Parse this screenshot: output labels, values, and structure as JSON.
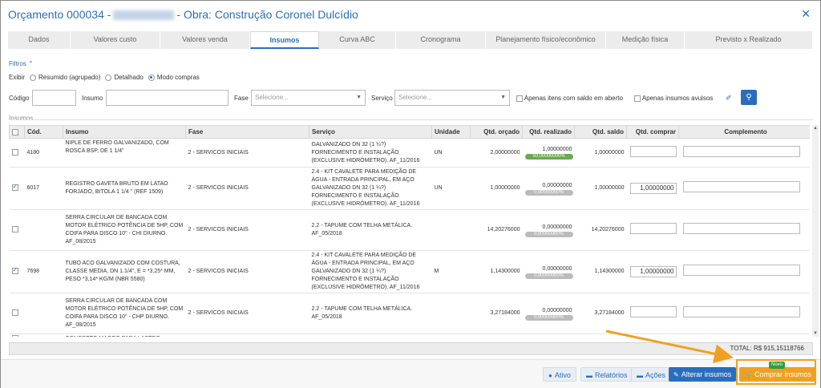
{
  "header": {
    "title_prefix": "Orçamento 000034 -",
    "title_suffix": "- Obra: Construção Coronel Dulcídio",
    "close_glyph": "✕"
  },
  "tabs": [
    {
      "label": "Dados"
    },
    {
      "label": "Valores custo"
    },
    {
      "label": "Valores venda"
    },
    {
      "label": "Insumos"
    },
    {
      "label": "Curva ABC"
    },
    {
      "label": "Cronograma"
    },
    {
      "label": "Planejamento físico/econômico"
    },
    {
      "label": "Medição física"
    },
    {
      "label": "Previsto x Realizado"
    }
  ],
  "active_tab": "Insumos",
  "filters": {
    "heading": "Filtros",
    "exibir_label": "Exibir",
    "exibir_options": [
      "Resumido (agrupado)",
      "Detalhado",
      "Modo compras"
    ],
    "exibir_selected": "Modo compras",
    "codigo_label": "Código",
    "insumo_label": "Insumo",
    "fase_label": "Fase",
    "fase_placeholder": "Selecione...",
    "servico_label": "Serviço",
    "servico_placeholder": "Selecione...",
    "saldo_label": "Apenas itens com saldo em aberto",
    "avulsos_label": "Apenas insumos avulsos"
  },
  "section_label": "Insumos",
  "table": {
    "columns": [
      "Cód.",
      "Insumo",
      "Fase",
      "Serviço",
      "Unidade",
      "Qtd. orçado",
      "Qtd. realizado",
      "Qtd. saldo",
      "Qtd. comprar",
      "Complemento"
    ],
    "rows": [
      {
        "checked": false,
        "cod": "4180",
        "insumo": "NIPLE DE FERRO GALVANIZADO, COM ROSCA BSP, DE 1 1/4\"",
        "fase": "2 - SERVICOS INICIAIS",
        "servico": "GALVANIZADO DN 32 (1 ¼?) FORNECIMENTO E INSTALAÇÃO (EXCLUSIVE HIDRÔMETRO). AF_11/2016",
        "unidade": "UN",
        "orcado": "2,00000000",
        "realizado": "1,00000000",
        "pill": "50,00000000%",
        "pill_green": true,
        "saldo": "1,00000000",
        "comprar": ""
      },
      {
        "checked": true,
        "cod": "6017",
        "insumo": "REGISTRO GAVETA BRUTO EM LATAO FORJADO, BITOLA 1 1/4 \" (REF 1509)",
        "fase": "2 - SERVICOS INICIAIS",
        "servico": "2.4 - KIT CAVALETE PARA MEDIÇÃO DE ÁGUA - ENTRADA PRINCIPAL, EM AÇO GALVANIZADO DN 32 (1 ¼?) FORNECIMENTO E INSTALAÇÃO (EXCLUSIVE HIDRÔMETRO). AF_11/2016",
        "unidade": "UN",
        "orcado": "1,00000000",
        "realizado": "0,00000000",
        "pill": "0,00000000%",
        "pill_green": false,
        "saldo": "1,00000000",
        "comprar": "1,00000000"
      },
      {
        "checked": false,
        "cod": "",
        "insumo": "SERRA CIRCULAR DE BANCADA COM MOTOR ELÉTRICO POTÊNCIA DE 5HP, COM COIFA PARA DISCO 10\" - CHI DIURNO. AF_08/2015",
        "fase": "2 - SERVICOS INICIAIS",
        "servico": "2.2 - TAPUME COM TELHA METÁLICA. AF_05/2018",
        "unidade": "",
        "orcado": "14,20276000",
        "realizado": "0,00000000",
        "pill": "0,00000000%",
        "pill_green": false,
        "saldo": "14,20276000",
        "comprar": ""
      },
      {
        "checked": true,
        "cod": "7698",
        "insumo": "TUBO ACO GALVANIZADO COM COSTURA, CLASSE MEDIA, DN 1.1/4\", E = *3,25* MM, PESO *3,14* KG/M (NBR 5580)",
        "fase": "2 - SERVICOS INICIAIS",
        "servico": "2.4 - KIT CAVALETE PARA MEDIÇÃO DE ÁGUA - ENTRADA PRINCIPAL, EM AÇO GALVANIZADO DN 32 (1 ¼?) FORNECIMENTO E INSTALAÇÃO (EXCLUSIVE HIDRÔMETRO). AF_11/2016",
        "unidade": "M",
        "orcado": "1,14300000",
        "realizado": "0,00000000",
        "pill": "0,00000000%",
        "pill_green": false,
        "saldo": "1,14300000",
        "comprar": "1,00000000"
      },
      {
        "checked": false,
        "cod": "",
        "insumo": "SERRA CIRCULAR DE BANCADA COM MOTOR ELÉTRICO POTÊNCIA DE 5HP, COM COIFA PARA DISCO 10\" - CHP DIURNO. AF_08/2015",
        "fase": "2 - SERVICOS INICIAIS",
        "servico": "2.2 - TAPUME COM TELHA METÁLICA. AF_05/2018",
        "unidade": "",
        "orcado": "3,27184000",
        "realizado": "0,00000000",
        "pill": "0,00000000%",
        "pill_green": false,
        "saldo": "3,27184000",
        "comprar": ""
      },
      {
        "checked": false,
        "cod": "",
        "insumo": "CONCRETO MAGRO PARA LASTRO,",
        "fase": "",
        "servico": "",
        "unidade": "",
        "orcado": "",
        "realizado": "",
        "pill": "",
        "pill_green": false,
        "saldo": "",
        "comprar": ""
      }
    ]
  },
  "total": "TOTAL: R$ 915,15118766",
  "footer": {
    "ativo": "Ativo",
    "relatorios": "Relatórios",
    "acoes": "Ações",
    "alterar": "Alterar insumos",
    "comprar": "Comprar insumos",
    "novo_badge": "Novo"
  },
  "colors": {
    "accent": "#2a6ebb",
    "highlight": "#f0a020",
    "badge": "#2f9e44"
  }
}
